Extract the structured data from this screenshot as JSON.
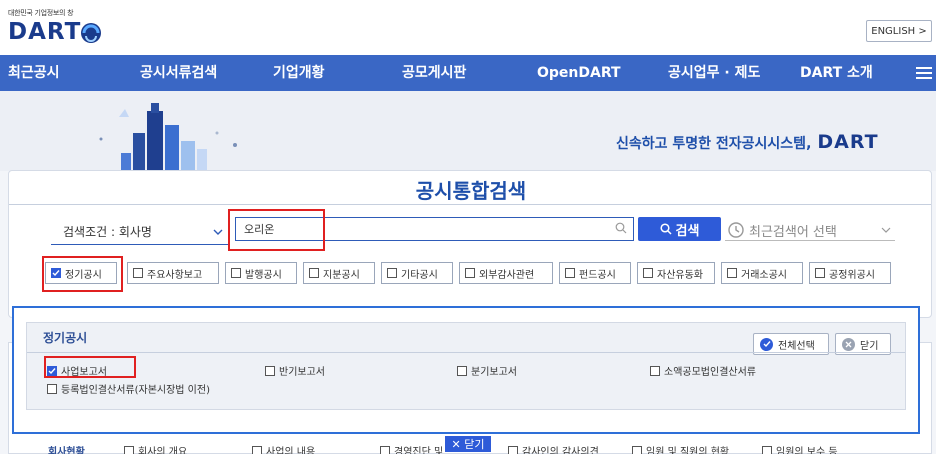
{
  "header": {
    "logo_subtitle": "대한민국 기업정보의 창",
    "logo_text": "DART",
    "english_button": "ENGLISH >"
  },
  "nav": {
    "items": [
      "최근공시",
      "공시서류검색",
      "기업개황",
      "공모게시판",
      "OpenDART",
      "공시업무 · 제도",
      "DART 소개"
    ]
  },
  "hero": {
    "slogan": "신속하고 투명한 전자공시시스템,",
    "slogan_brand": "DART"
  },
  "search": {
    "title": "공시통합검색",
    "condition_label": "검색조건 : 회사명",
    "query_value": "오리온",
    "search_button": "검색",
    "recent_label": "최근검색어 선택"
  },
  "filters": [
    {
      "label": "정기공시",
      "checked": true
    },
    {
      "label": "주요사항보고",
      "checked": false
    },
    {
      "label": "발행공시",
      "checked": false
    },
    {
      "label": "지분공시",
      "checked": false
    },
    {
      "label": "기타공시",
      "checked": false
    },
    {
      "label": "외부감사관련",
      "checked": false
    },
    {
      "label": "펀드공시",
      "checked": false
    },
    {
      "label": "자산유동화",
      "checked": false
    },
    {
      "label": "거래소공시",
      "checked": false
    },
    {
      "label": "공정위공시",
      "checked": false
    }
  ],
  "popup": {
    "title": "정기공시",
    "select_all": "전체선택",
    "close": "닫기",
    "items": [
      {
        "label": "사업보고서",
        "checked": true
      },
      {
        "label": "반기보고서",
        "checked": false
      },
      {
        "label": "분기보고서",
        "checked": false
      },
      {
        "label": "소액공모법인결산서류",
        "checked": false
      },
      {
        "label": "등록법인결산서류(자본시장법 이전)",
        "checked": false
      }
    ],
    "close_tab": "✕ 닫기"
  },
  "bottom": {
    "heading": "회사현황",
    "items": [
      "회사의 개요",
      "사업의 내용",
      "경영진단 및",
      "감사인의 감사의견",
      "임원 및 직원의 현황",
      "임원의 보수 등"
    ]
  },
  "colors": {
    "nav_bg": "#3a67c5",
    "brand_blue": "#1a3b8c",
    "accent_blue": "#2e5bd8",
    "highlight_red": "#e02020"
  }
}
